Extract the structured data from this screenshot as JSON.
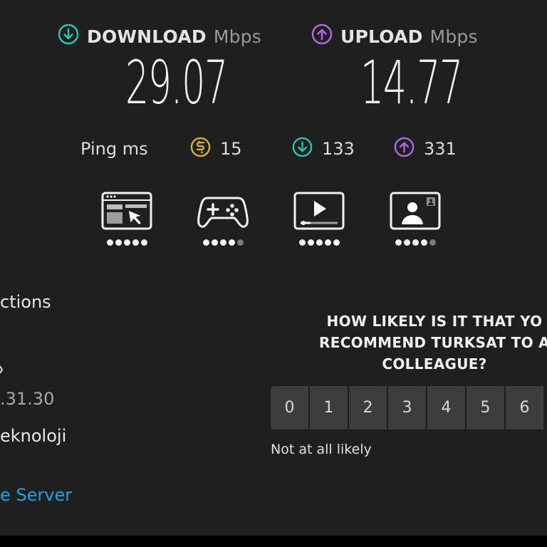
{
  "download": {
    "label": "DOWNLOAD",
    "unit": "Mbps",
    "value": "29.07",
    "color": "#27c2b0"
  },
  "upload": {
    "label": "UPLOAD",
    "unit": "Mbps",
    "value": "14.77",
    "color": "#b266e0"
  },
  "ping": {
    "label": "Ping ms",
    "idle": "15",
    "download": "133",
    "upload": "331",
    "idle_color": "#d4b22e"
  },
  "use_cases": [
    {
      "icon": "web-browsing-icon",
      "rating": 5
    },
    {
      "icon": "gaming-icon",
      "rating": 4
    },
    {
      "icon": "video-streaming-icon",
      "rating": 5
    },
    {
      "icon": "video-chat-icon",
      "rating": 4
    }
  ],
  "left_panel": {
    "connections": "ctions",
    "ip_partial": ".31.30",
    "provider_partial": "eknoloji",
    "change_server": "e Server",
    "link_color": "#1da1e6"
  },
  "survey": {
    "question_lines": [
      "HOW LIKELY IS IT THAT YO",
      "RECOMMEND TURKSAT TO A",
      "COLLEAGUE?"
    ],
    "scale": [
      "0",
      "1",
      "2",
      "3",
      "4",
      "5",
      "6"
    ],
    "low_label": "Not at all likely"
  }
}
